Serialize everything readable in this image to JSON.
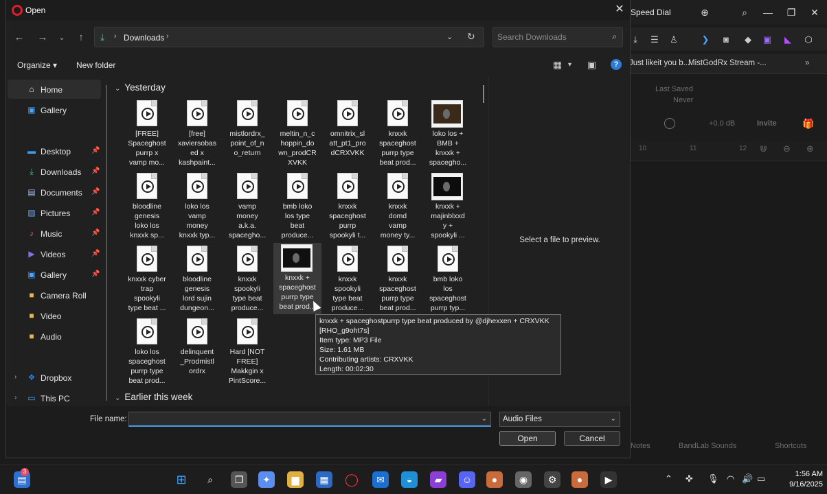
{
  "browser": {
    "tab_title": "Speed Dial",
    "bookmarks": [
      "Just likeit you b...",
      "MistGodRx Stream -..."
    ],
    "app": {
      "last_saved_label": "Last Saved",
      "last_saved_value": "Never",
      "db_value": "+0.0 dB",
      "invite_label": "Invite",
      "ruler": [
        "10",
        "11",
        "12"
      ],
      "bottom_items": [
        "Notes",
        "BandLab Sounds",
        "Shortcuts"
      ]
    }
  },
  "dialog": {
    "title": "Open",
    "address": {
      "crumb": "Downloads"
    },
    "search": {
      "placeholder": "Search Downloads"
    },
    "commands": {
      "organize": "Organize",
      "new_folder": "New folder"
    },
    "sidebar": {
      "items": [
        {
          "label": "Home",
          "icon": "home-icon",
          "pinned": false
        },
        {
          "label": "Gallery",
          "icon": "gallery-icon",
          "pinned": false
        },
        {
          "label": "Desktop",
          "icon": "desktop-icon",
          "pinned": true
        },
        {
          "label": "Downloads",
          "icon": "download-icon",
          "pinned": true
        },
        {
          "label": "Documents",
          "icon": "documents-icon",
          "pinned": true
        },
        {
          "label": "Pictures",
          "icon": "pictures-icon",
          "pinned": true
        },
        {
          "label": "Music",
          "icon": "music-icon",
          "pinned": true
        },
        {
          "label": "Videos",
          "icon": "videos-icon",
          "pinned": true
        },
        {
          "label": "Gallery",
          "icon": "gallery-icon",
          "pinned": true
        },
        {
          "label": "Camera Roll",
          "icon": "folder-icon",
          "pinned": false
        },
        {
          "label": "Video",
          "icon": "folder-icon",
          "pinned": false
        },
        {
          "label": "Audio",
          "icon": "folder-icon",
          "pinned": false
        },
        {
          "label": "Dropbox",
          "icon": "dropbox-icon",
          "pinned": false
        },
        {
          "label": "This PC",
          "icon": "pc-icon",
          "pinned": false
        }
      ]
    },
    "groups": {
      "yesterday": "Yesterday",
      "earlier": "Earlier this week"
    },
    "files": [
      {
        "label": "[FREE]\nSpaceghost\npurrp x\nvamp mo...",
        "kind": "audio"
      },
      {
        "label": "[free]\nxaviersobas\ned x\nkashpaint...",
        "kind": "audio"
      },
      {
        "label": "mistlordrx_\npoint_of_n\no_return",
        "kind": "audio"
      },
      {
        "label": "meltin_n_c\nhoppin_do\nwn_prodCR\nXVKK",
        "kind": "audio"
      },
      {
        "label": "omnitrix_sl\natt_pt1_pro\ndCRXVKK",
        "kind": "audio"
      },
      {
        "label": "knxxk\nspaceghost\npurrp type\nbeat prod...",
        "kind": "audio"
      },
      {
        "label": "loko los +\nBMB +\nknxxk +\nspacegho...",
        "kind": "image1"
      },
      {
        "label": "bloodline\ngenesis\nloko los\nknxxk  sp...",
        "kind": "audio"
      },
      {
        "label": "loko los\nvamp\nmoney\nknxxk typ...",
        "kind": "audio"
      },
      {
        "label": "vamp\nmoney\na.k.a.\nspacegho...",
        "kind": "audio"
      },
      {
        "label": "bmb loko\nlos type\nbeat\nproduce...",
        "kind": "audio"
      },
      {
        "label": "knxxk\nspaceghost\npurrp\nspookyli t...",
        "kind": "audio"
      },
      {
        "label": "knxxk\ndomd\nvamp\nmoney ty...",
        "kind": "audio"
      },
      {
        "label": "knxxk +\nmajinblxxd\ny +\nspookyli ...",
        "kind": "image2"
      },
      {
        "label": "knxxk  cyber\ntrap\nspookyli\ntype beat ...",
        "kind": "audio"
      },
      {
        "label": "bloodline\ngenesis\nlord sujin\ndungeon...",
        "kind": "audio"
      },
      {
        "label": "knxxk\nspookyli\ntype beat\nproduce...",
        "kind": "audio"
      },
      {
        "label": "knxxk +\nspaceghost\npurrp type\nbeat prod...",
        "kind": "image3"
      },
      {
        "label": "knxxk\nspookyli\ntype beat\nproduce...",
        "kind": "audio"
      },
      {
        "label": "knxxk\nspaceghost\npurrp type\nbeat prod...",
        "kind": "audio"
      },
      {
        "label": "bmb loko\nlos\nspaceghost\npurrp typ...",
        "kind": "audio"
      },
      {
        "label": "loko los\nspaceghost\npurrp type\nbeat prod...",
        "kind": "audio"
      },
      {
        "label": "delinquent\n_Prodmistl\nordrx",
        "kind": "audio"
      },
      {
        "label": "Hard [NOT\nFREE]\nMakkgin x\nPintScore...",
        "kind": "audio"
      }
    ],
    "preview_message": "Select a file to preview.",
    "tooltip": [
      "knxxk + spaceghostpurrp type beat produced by @djhexxen + CRXVKK",
      "[RHO_g9oht7s]",
      "Item type: MP3 File",
      "Size: 1.61 MB",
      "Contributing artists: CRXVKK",
      "Length: 00:02:30"
    ],
    "bottom": {
      "file_name_label": "File name:",
      "file_name_value": "",
      "file_type": "Audio Files",
      "open_label": "Open",
      "cancel_label": "Cancel"
    }
  },
  "taskbar": {
    "notification_count": "3",
    "time": "1:56 AM",
    "date": "9/16/2025"
  }
}
